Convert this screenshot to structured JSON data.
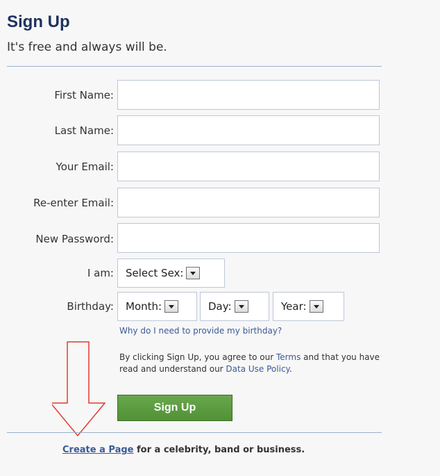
{
  "header": {
    "title": "Sign Up",
    "subtitle": "It's free and always will be."
  },
  "form": {
    "fields": [
      {
        "label": "First Name:",
        "value": ""
      },
      {
        "label": "Last Name:",
        "value": ""
      },
      {
        "label": "Your Email:",
        "value": ""
      },
      {
        "label": "Re-enter Email:",
        "value": ""
      },
      {
        "label": "New Password:",
        "value": ""
      }
    ],
    "sex_label": "I am:",
    "sex_select": "Select Sex:",
    "birthday_label": "Birthday:",
    "month_select": "Month:",
    "day_select": "Day:",
    "year_select": "Year:",
    "birthday_help": "Why do I need to provide my birthday?",
    "terms_prefix": "By clicking Sign Up, you agree to our ",
    "terms_link": "Terms",
    "terms_middle": " and that you have read and understand our ",
    "policy_link": "Data Use Policy",
    "terms_suffix": ".",
    "submit_label": "Sign Up"
  },
  "footer": {
    "link": "Create a Page",
    "text": " for a celebrity, band or business."
  },
  "colors": {
    "title": "#203360",
    "link": "#3b5998",
    "button": "#519235",
    "arrow": "#e23a2f"
  },
  "icons": [
    "dropdown-arrow-icon",
    "down-arrow-annotation-icon"
  ]
}
